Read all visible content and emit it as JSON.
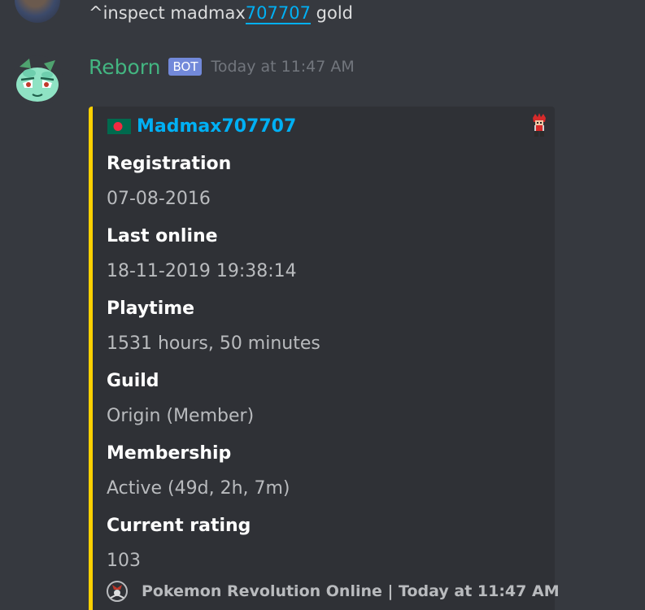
{
  "previous_message": {
    "text_prefix": "^inspect madmax",
    "mention": "707707",
    "text_suffix": " gold"
  },
  "message": {
    "author": "Reborn",
    "bot_tag": "BOT",
    "timestamp": "Today at 11:47 AM",
    "author_color": "#43b581",
    "avatar_icon": "bulbasaur-icon"
  },
  "embed": {
    "accent_color": "#fdd000",
    "author_icon": "bangladesh-flag-icon",
    "author_name": "Madmax707707",
    "thumbnail_icon": "trainer-sprite-icon",
    "fields": [
      {
        "name": "Registration",
        "value": "07-08-2016"
      },
      {
        "name": "Last online",
        "value": "18-11-2019 19:38:14"
      },
      {
        "name": "Playtime",
        "value": "1531 hours, 50 minutes"
      },
      {
        "name": "Guild",
        "value": "Origin (Member)"
      },
      {
        "name": "Membership",
        "value": "Active (49d, 2h, 7m)"
      },
      {
        "name": "Current rating",
        "value": "103"
      }
    ],
    "footer_icon": "pokemon-revolution-logo-icon",
    "footer_text": "Pokemon Revolution Online | Today at 11:47 AM"
  }
}
